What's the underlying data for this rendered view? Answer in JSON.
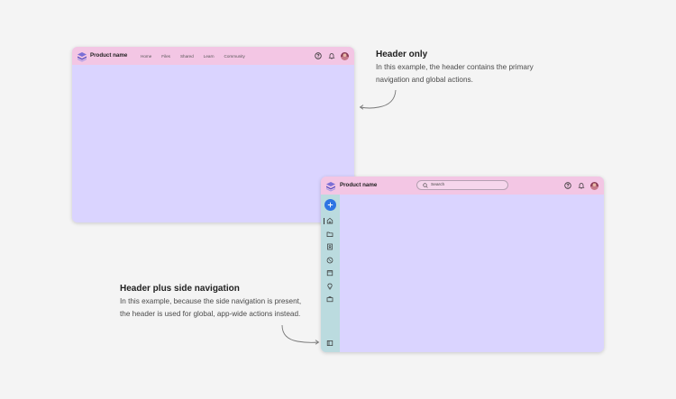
{
  "example1": {
    "product_name": "Product name",
    "nav": [
      "Home",
      "Files",
      "Shared",
      "Learn",
      "Community"
    ],
    "actions": [
      "help-icon",
      "bell-icon",
      "avatar"
    ]
  },
  "example2": {
    "product_name": "Product name",
    "search_placeholder": "Search",
    "actions": [
      "help-icon",
      "bell-icon",
      "avatar"
    ],
    "sidenav": [
      "add-icon",
      "home-icon",
      "folder-icon",
      "certificate-icon",
      "explore-icon",
      "calendar-icon",
      "lightbulb-icon",
      "briefcase-icon",
      "panel-toggle-icon"
    ]
  },
  "annotations": {
    "header_only": {
      "title": "Header only",
      "lines": [
        "In this example, the header contains the primary",
        "navigation and global actions."
      ]
    },
    "header_plus_side_nav": {
      "title": "Header plus side navigation",
      "lines": [
        "In this example, because the side navigation is present,",
        "the header is used for global, app-wide actions instead."
      ]
    }
  },
  "colors": {
    "page_bg": "#f4f4f4",
    "header_bg": "#f3c6e4",
    "content_bg": "#dad4ff",
    "sidenav_bg": "#bbdbdf",
    "accent_blue": "#2d74e3"
  }
}
